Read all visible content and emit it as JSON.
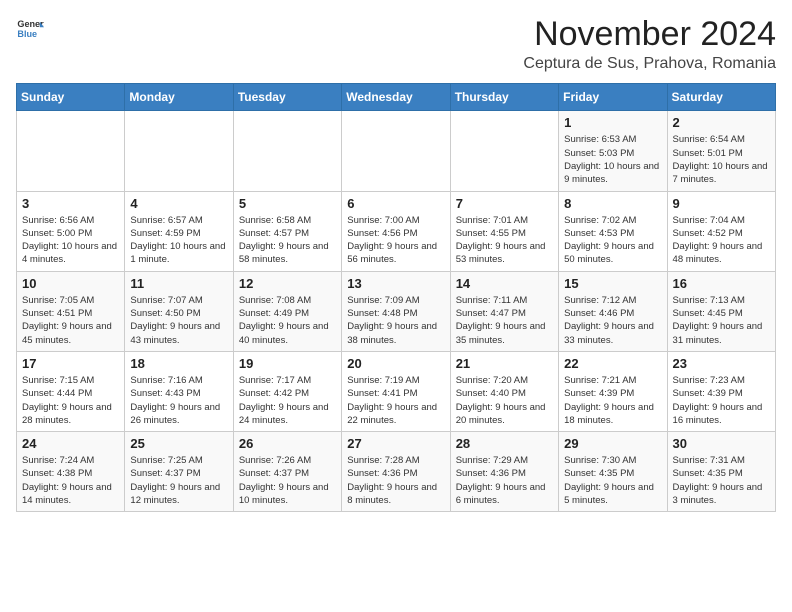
{
  "header": {
    "logo_general": "General",
    "logo_blue": "Blue",
    "month_title": "November 2024",
    "location": "Ceptura de Sus, Prahova, Romania"
  },
  "weekdays": [
    "Sunday",
    "Monday",
    "Tuesday",
    "Wednesday",
    "Thursday",
    "Friday",
    "Saturday"
  ],
  "weeks": [
    [
      {
        "day": "",
        "info": ""
      },
      {
        "day": "",
        "info": ""
      },
      {
        "day": "",
        "info": ""
      },
      {
        "day": "",
        "info": ""
      },
      {
        "day": "",
        "info": ""
      },
      {
        "day": "1",
        "info": "Sunrise: 6:53 AM\nSunset: 5:03 PM\nDaylight: 10 hours and 9 minutes."
      },
      {
        "day": "2",
        "info": "Sunrise: 6:54 AM\nSunset: 5:01 PM\nDaylight: 10 hours and 7 minutes."
      }
    ],
    [
      {
        "day": "3",
        "info": "Sunrise: 6:56 AM\nSunset: 5:00 PM\nDaylight: 10 hours and 4 minutes."
      },
      {
        "day": "4",
        "info": "Sunrise: 6:57 AM\nSunset: 4:59 PM\nDaylight: 10 hours and 1 minute."
      },
      {
        "day": "5",
        "info": "Sunrise: 6:58 AM\nSunset: 4:57 PM\nDaylight: 9 hours and 58 minutes."
      },
      {
        "day": "6",
        "info": "Sunrise: 7:00 AM\nSunset: 4:56 PM\nDaylight: 9 hours and 56 minutes."
      },
      {
        "day": "7",
        "info": "Sunrise: 7:01 AM\nSunset: 4:55 PM\nDaylight: 9 hours and 53 minutes."
      },
      {
        "day": "8",
        "info": "Sunrise: 7:02 AM\nSunset: 4:53 PM\nDaylight: 9 hours and 50 minutes."
      },
      {
        "day": "9",
        "info": "Sunrise: 7:04 AM\nSunset: 4:52 PM\nDaylight: 9 hours and 48 minutes."
      }
    ],
    [
      {
        "day": "10",
        "info": "Sunrise: 7:05 AM\nSunset: 4:51 PM\nDaylight: 9 hours and 45 minutes."
      },
      {
        "day": "11",
        "info": "Sunrise: 7:07 AM\nSunset: 4:50 PM\nDaylight: 9 hours and 43 minutes."
      },
      {
        "day": "12",
        "info": "Sunrise: 7:08 AM\nSunset: 4:49 PM\nDaylight: 9 hours and 40 minutes."
      },
      {
        "day": "13",
        "info": "Sunrise: 7:09 AM\nSunset: 4:48 PM\nDaylight: 9 hours and 38 minutes."
      },
      {
        "day": "14",
        "info": "Sunrise: 7:11 AM\nSunset: 4:47 PM\nDaylight: 9 hours and 35 minutes."
      },
      {
        "day": "15",
        "info": "Sunrise: 7:12 AM\nSunset: 4:46 PM\nDaylight: 9 hours and 33 minutes."
      },
      {
        "day": "16",
        "info": "Sunrise: 7:13 AM\nSunset: 4:45 PM\nDaylight: 9 hours and 31 minutes."
      }
    ],
    [
      {
        "day": "17",
        "info": "Sunrise: 7:15 AM\nSunset: 4:44 PM\nDaylight: 9 hours and 28 minutes."
      },
      {
        "day": "18",
        "info": "Sunrise: 7:16 AM\nSunset: 4:43 PM\nDaylight: 9 hours and 26 minutes."
      },
      {
        "day": "19",
        "info": "Sunrise: 7:17 AM\nSunset: 4:42 PM\nDaylight: 9 hours and 24 minutes."
      },
      {
        "day": "20",
        "info": "Sunrise: 7:19 AM\nSunset: 4:41 PM\nDaylight: 9 hours and 22 minutes."
      },
      {
        "day": "21",
        "info": "Sunrise: 7:20 AM\nSunset: 4:40 PM\nDaylight: 9 hours and 20 minutes."
      },
      {
        "day": "22",
        "info": "Sunrise: 7:21 AM\nSunset: 4:39 PM\nDaylight: 9 hours and 18 minutes."
      },
      {
        "day": "23",
        "info": "Sunrise: 7:23 AM\nSunset: 4:39 PM\nDaylight: 9 hours and 16 minutes."
      }
    ],
    [
      {
        "day": "24",
        "info": "Sunrise: 7:24 AM\nSunset: 4:38 PM\nDaylight: 9 hours and 14 minutes."
      },
      {
        "day": "25",
        "info": "Sunrise: 7:25 AM\nSunset: 4:37 PM\nDaylight: 9 hours and 12 minutes."
      },
      {
        "day": "26",
        "info": "Sunrise: 7:26 AM\nSunset: 4:37 PM\nDaylight: 9 hours and 10 minutes."
      },
      {
        "day": "27",
        "info": "Sunrise: 7:28 AM\nSunset: 4:36 PM\nDaylight: 9 hours and 8 minutes."
      },
      {
        "day": "28",
        "info": "Sunrise: 7:29 AM\nSunset: 4:36 PM\nDaylight: 9 hours and 6 minutes."
      },
      {
        "day": "29",
        "info": "Sunrise: 7:30 AM\nSunset: 4:35 PM\nDaylight: 9 hours and 5 minutes."
      },
      {
        "day": "30",
        "info": "Sunrise: 7:31 AM\nSunset: 4:35 PM\nDaylight: 9 hours and 3 minutes."
      }
    ]
  ]
}
